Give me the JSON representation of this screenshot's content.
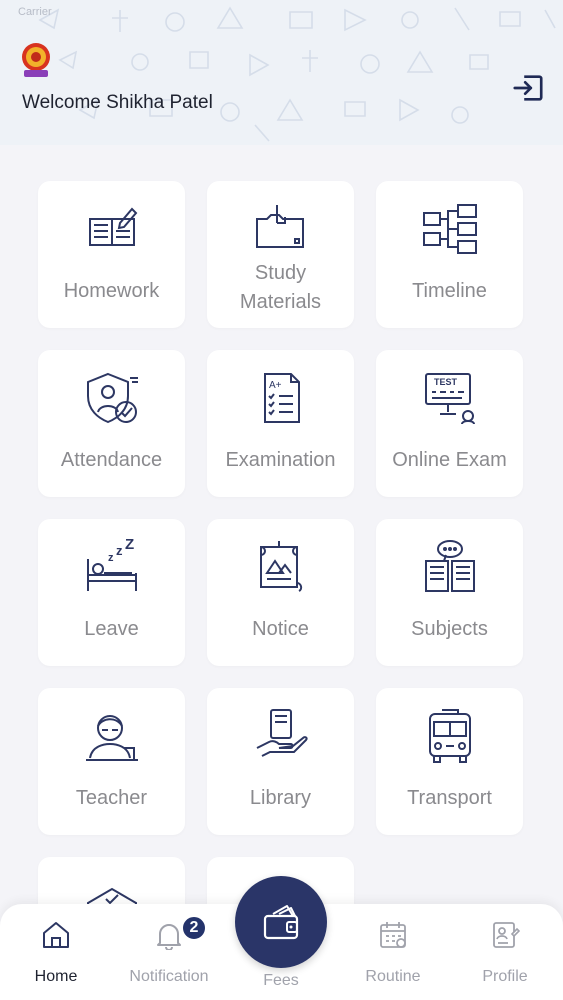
{
  "status": {
    "carrier": "Carrier"
  },
  "header": {
    "welcome": "Welcome Shikha Patel",
    "logo_icon": "school-logo-icon",
    "logout_icon": "logout-icon"
  },
  "tiles": [
    {
      "label": "Homework",
      "icon": "homework-icon"
    },
    {
      "label": "Study Materials",
      "line1": "Study",
      "line2": "Materials",
      "icon": "study-materials-icon"
    },
    {
      "label": "Timeline",
      "icon": "timeline-icon"
    },
    {
      "label": "Attendance",
      "icon": "attendance-icon"
    },
    {
      "label": "Examination",
      "icon": "examination-icon"
    },
    {
      "label": "Online Exam",
      "icon": "online-exam-icon"
    },
    {
      "label": "Leave",
      "icon": "leave-icon"
    },
    {
      "label": "Notice",
      "icon": "notice-icon"
    },
    {
      "label": "Subjects",
      "icon": "subjects-icon"
    },
    {
      "label": "Teacher",
      "icon": "teacher-icon"
    },
    {
      "label": "Library",
      "icon": "library-icon"
    },
    {
      "label": "Transport",
      "icon": "transport-icon"
    }
  ],
  "bottom_nav": {
    "home": "Home",
    "notification": "Notification",
    "notification_count": "2",
    "fees": "Fees",
    "routine": "Routine",
    "profile": "Profile"
  },
  "colors": {
    "accent": "#2a3568",
    "icon": "#2d3763",
    "label": "#8a8a8e",
    "background": "#f4f4f8"
  }
}
